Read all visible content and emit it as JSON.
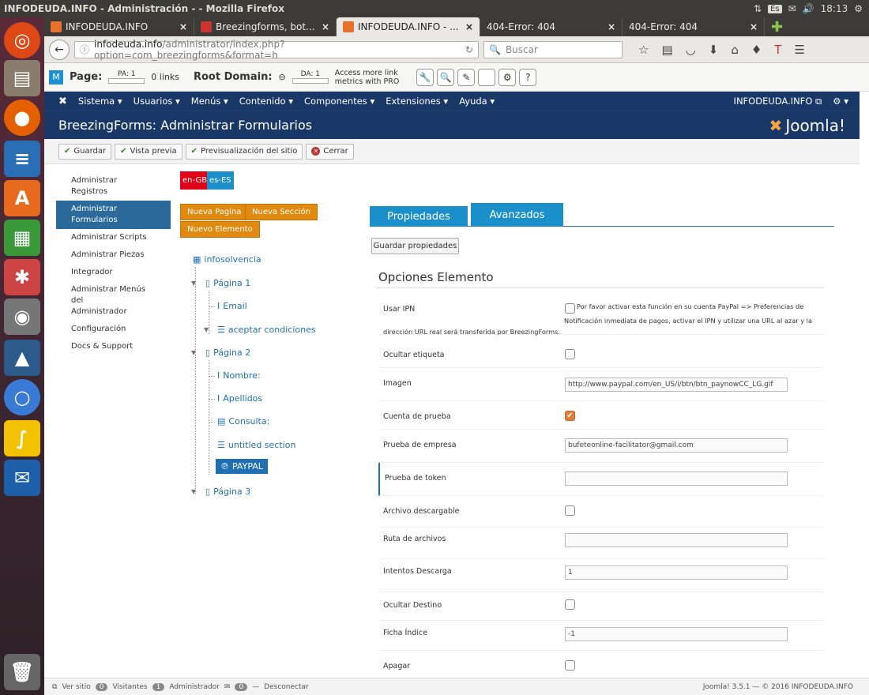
{
  "os": {
    "window_title": "INFODEUDA.INFO - Administración - - Mozilla Firefox",
    "kbd": "Es",
    "time": "18:13"
  },
  "launcher": {
    "items": [
      "ubuntu-icon",
      "files-icon",
      "firefox-icon",
      "writer-icon",
      "software-center-icon",
      "calc-icon",
      "settings-icon",
      "gimp-icon",
      "inkscape-icon",
      "chromium-icon",
      "python-icon",
      "thunderbird-icon",
      "trash-icon"
    ]
  },
  "browser": {
    "tabs": [
      {
        "label": "INFODEUDA.INFO",
        "fav": "#e8722a"
      },
      {
        "label": "Breezingforms, bot...",
        "fav": "#c33"
      },
      {
        "label": "INFODEUDA.INFO - ...",
        "fav": "#e8722a"
      },
      {
        "label": "404-Error: 404",
        "fav": ""
      },
      {
        "label": "404-Error: 404",
        "fav": ""
      }
    ],
    "url_domain": "infodeuda.info",
    "url_path": "/administrator/index.php?option=com_breezingforms&format=h",
    "search_placeholder": "Buscar"
  },
  "seobar": {
    "page": "Page:",
    "pa": "PA: 1",
    "links": "0 links",
    "root_domain": "Root Domain:",
    "da": "DA: 1",
    "access": "Access more link",
    "metrics": "metrics with PRO"
  },
  "jnav": {
    "items": [
      "Sistema ▾",
      "Usuarios ▾",
      "Menús ▾",
      "Contenido ▾",
      "Componentes ▾",
      "Extensiones ▾",
      "Ayuda ▾"
    ],
    "site": "INFODEUDA.INFO ⧉",
    "gear": "⚙ ▾"
  },
  "jhead": {
    "title": "BreezingForms: Administrar Formularios",
    "logo": "Joomla!"
  },
  "toolbar": {
    "save": "Guardar",
    "preview": "Vista previa",
    "site_preview": "Previsualización del sitio",
    "close": "Cerrar"
  },
  "sidebar": {
    "items": [
      "Administrar Registros",
      "Administrar Formularios",
      "Administrar Scripts",
      "Administrar Piezas",
      "Integrador",
      "Administrar Menús del",
      "Administrador",
      "Configuración",
      "Docs & Support"
    ]
  },
  "langs": {
    "en": "en-GB",
    "es": "es-ES"
  },
  "actions": {
    "new_page": "Nueva Pagina",
    "new_section": "Nueva Sección",
    "new_element": "Nuevo Elemento"
  },
  "tree": {
    "root": "infosolvencia",
    "p1": "Página 1",
    "email": "Email",
    "terms": "aceptar condiciones",
    "p2": "Página 2",
    "nombre": "Nombre:",
    "apellidos": "Apellidos",
    "consulta": "Consulta:",
    "untitled": "untitled section",
    "paypal": "PAYPAL",
    "p3": "Página 3"
  },
  "ptabs": {
    "props": "Propiedades",
    "advanced": "Avanzados"
  },
  "save_props": "Guardar propiedades",
  "options_title": "Opciones Elemento",
  "options": {
    "ipn_label": "Usar IPN",
    "ipn_text1": "Por favor activar esta función en su cuenta PayPal => Preferencias de",
    "ipn_text2": "Notificación inmediata de pagos, activar el IPN y utilizar una URL al azar y la",
    "ipn_text3": "dirección URL real será transferida por BreezingForms.",
    "hide_label": "Ocultar etiqueta",
    "image_label": "Imagen",
    "image_value": "http://www.paypal.com/en_US/i/btn/btn_paynowCC_LG.gif",
    "test_account": "Cuenta de prueba",
    "test_business": "Prueba de empresa",
    "test_business_value": "bufeteonline-facilitator@gmail.com",
    "test_token": "Prueba de token",
    "download_file": "Archivo descargable",
    "file_path": "Ruta de archivos",
    "download_tries": "Intentos Descarga",
    "download_tries_value": "1",
    "hide_target": "Ocultar Destino",
    "ticket_index": "Ficha Índice",
    "ticket_index_value": "-1",
    "turn_off": "Apagar"
  },
  "status": {
    "view_site": "Ver sitio",
    "visitors_count": "0",
    "visitors": "Visitantes",
    "admin_count": "1",
    "admin": "Administrador",
    "mail_count": "0",
    "logout": "Desconectar",
    "version": "Joomla! 3.5.1  —  © 2016 INFODEUDA.INFO"
  }
}
